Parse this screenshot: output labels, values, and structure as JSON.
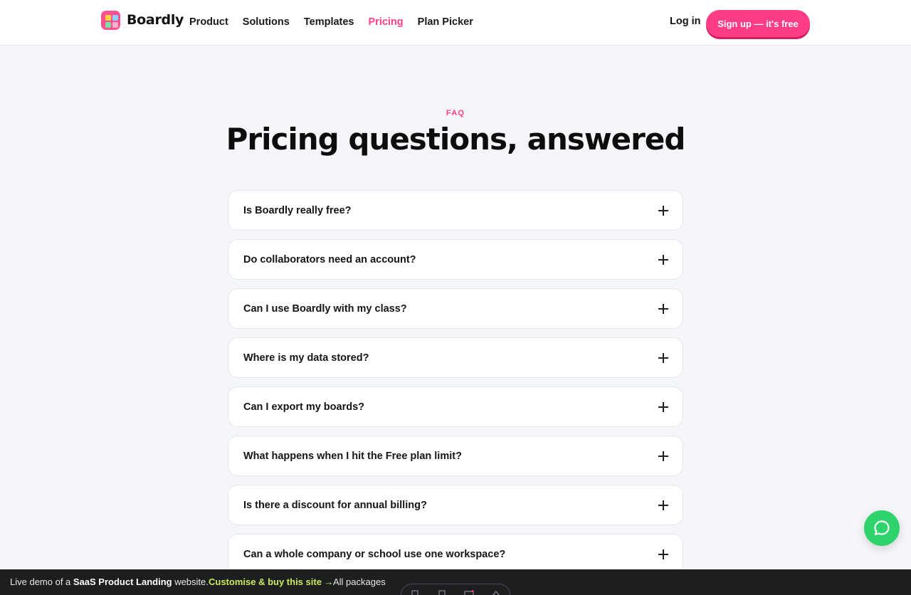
{
  "brand": {
    "name": "Boardly",
    "accent": "#ff3d86"
  },
  "nav": {
    "items": [
      {
        "label": "Product",
        "active": false
      },
      {
        "label": "Solutions",
        "active": false
      },
      {
        "label": "Templates",
        "active": false
      },
      {
        "label": "Pricing",
        "active": true
      },
      {
        "label": "Plan Picker",
        "active": false
      }
    ],
    "login": "Log in",
    "signup": "Sign up — it's free"
  },
  "hero": {
    "eyebrow": "FAQ",
    "title": "Pricing questions, answered"
  },
  "faq": {
    "items": [
      {
        "question": "Is Boardly really free?"
      },
      {
        "question": "Do collaborators need an account?"
      },
      {
        "question": "Can I use Boardly with my class?"
      },
      {
        "question": "Where is my data stored?"
      },
      {
        "question": "Can I export my boards?"
      },
      {
        "question": "What happens when I hit the Free plan limit?"
      },
      {
        "question": "Is there a discount for annual billing?"
      },
      {
        "question": "Can a whole company or school use one workspace?"
      }
    ]
  },
  "chat": {
    "icon": "chat-bubble-icon",
    "color": "#2fd36b"
  },
  "bottom_bar": {
    "prefix": "Live demo of a ",
    "product": "SaaS Product Landing",
    "suffix": " website.",
    "cta": "Customise & buy this site →",
    "packages": "All packages",
    "device_icons": [
      "desktop-icon",
      "laptop-icon",
      "tablet-icon",
      "mobile-icon"
    ]
  }
}
